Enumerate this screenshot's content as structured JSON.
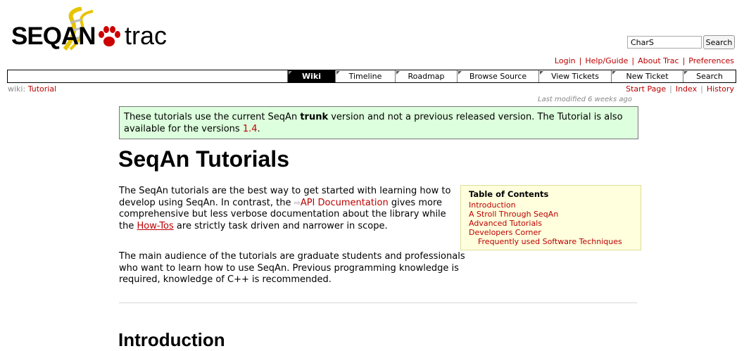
{
  "logo": {
    "brand_left": "SEQ",
    "brand_mid": "AN",
    "brand_right": "trac"
  },
  "search": {
    "value": "CharS",
    "button": "Search"
  },
  "metanav": [
    "Login",
    "Help/Guide",
    "About Trac",
    "Preferences"
  ],
  "mainnav": [
    {
      "label": "Wiki",
      "active": true
    },
    {
      "label": "Timeline"
    },
    {
      "label": "Roadmap"
    },
    {
      "label": "Browse Source"
    },
    {
      "label": "View Tickets"
    },
    {
      "label": "New Ticket"
    },
    {
      "label": "Search"
    }
  ],
  "breadcrumb": {
    "prefix": "wiki:",
    "page": "Tutorial"
  },
  "ctxtnav": [
    "Start Page",
    "Index",
    "History"
  ],
  "last_modified": "Last modified 6 weeks ago",
  "notice": {
    "part1": "These tutorials use the current SeqAn ",
    "bold": "trunk",
    "part2": " version and not a previous released version. The Tutorial is also available for the versions ",
    "link": "1.4",
    "part3": "."
  },
  "title": "SeqAn Tutorials",
  "para1": {
    "t1": "The SeqAn tutorials are the best way to get started with learning how to develop using SeqAn. In contrast, the ",
    "link1": "API Documentation",
    "t2": " gives more comprehensive but less verbose documentation about the library while the ",
    "link2": "How-Tos",
    "t3": " are strictly task driven and narrower in scope."
  },
  "para2": "The main audience of the tutorials are graduate students and professionals who want to learn how to use SeqAn. Previous programming knowledge is required, knowledge of C++ is recommended.",
  "toc": {
    "title": "Table of Contents",
    "items": [
      "Introduction",
      "A Stroll Through SeqAn",
      "Advanced Tutorials",
      "Developers Corner"
    ],
    "subitems": [
      "Frequently used Software Techniques"
    ]
  },
  "section_heading": "Introduction"
}
